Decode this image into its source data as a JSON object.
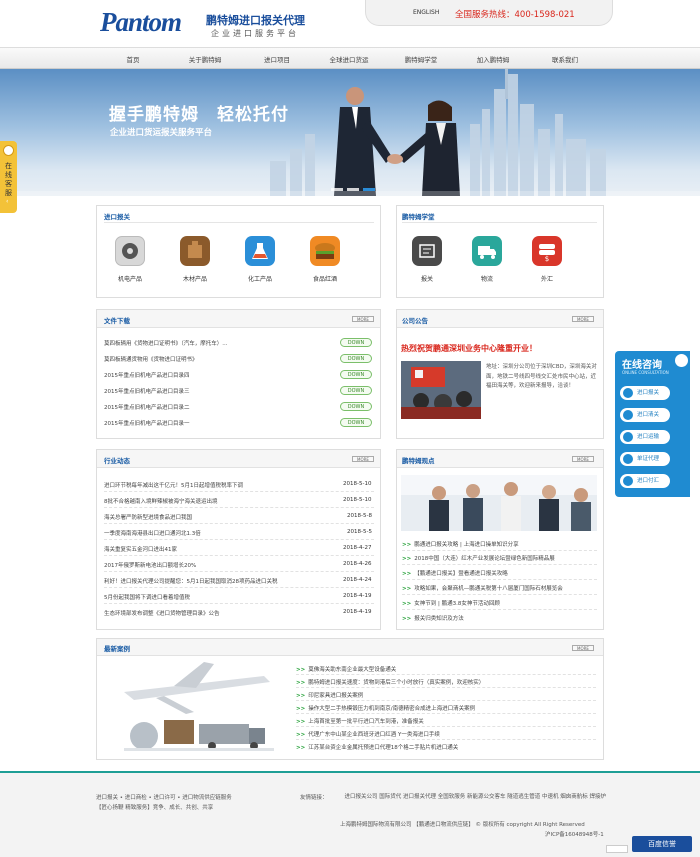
{
  "header": {
    "logo_word": "Pantom",
    "logo_cn1": "鹏特姆进口报关代理",
    "logo_cn2": "企业进口服务平台",
    "lang": "ENGLISH",
    "hotline": "全国服务热线：400-1598-021"
  },
  "nav": [
    "首页",
    "关于鹏特姆",
    "进口项目",
    "全球进口货运",
    "鹏特姆学堂",
    "加入鹏特姆",
    "联系我们"
  ],
  "banner": {
    "title": "握手鹏特姆　轻松托付",
    "subtitle": "企业进口货运报关服务平台"
  },
  "side_left": {
    "label": "在线客服"
  },
  "import_panel": {
    "title": "进口报关",
    "items": [
      "机电产品",
      "木材产品",
      "化工产品",
      "食品红酒"
    ]
  },
  "school_panel": {
    "title": "鹏特姆学堂",
    "items": [
      "报关",
      "物流",
      "外汇"
    ]
  },
  "download_panel": {
    "title": "文件下载",
    "more": "MORE",
    "down_label": "DOWN",
    "items": [
      "莫四板辆用《货物进口证明书》（汽车，摩托车）...",
      "莫四板辆通货物用《货物进口证明书》",
      "2015年重点旧机电产品进口目录四",
      "2015年重点旧机电产品进口目录三",
      "2015年重点旧机电产品进口目录二",
      "2015年重点旧机电产品进口目录一"
    ]
  },
  "notice_panel": {
    "title": "公司公告",
    "more": "MORE",
    "headline": "热烈祝贺鹏通深圳业务中心隆重开业！",
    "body": "地址：深圳分公司位于深圳CBD，深圳海关对面，地铁二号线四号线交汇处市民中心站，近福田海关等，欢迎新来报导，洽谈！"
  },
  "news_panel": {
    "title": "行业动态",
    "more": "MORE",
    "items": [
      {
        "text": "进口环节税每年减出这千亿元！5月1日起增值税税率下调",
        "date": "2018-5-10"
      },
      {
        "text": "8批不合格越南入境鲜辣椒被海宁海关退运出境",
        "date": "2018-5-10"
      },
      {
        "text": "海关总署严防新型进境食品进口我国",
        "date": "2018-5-8"
      },
      {
        "text": "一季度海南海港县出口进口通河北1.3倍",
        "date": "2018-5-5"
      },
      {
        "text": "海关重复实五金河口进出41家",
        "date": "2018-4-27"
      },
      {
        "text": "2017年俄罗斯新电池出口额增长20%",
        "date": "2018-4-26"
      },
      {
        "text": "利好！进口报关代理公司提醒您：5月1日起我国取消28项药品进口关税",
        "date": "2018-4-24"
      },
      {
        "text": "5月份起我国将下调进口看着增值税",
        "date": "2018-4-19"
      },
      {
        "text": "生态环境部发布调整《进口货物管理目录》公告",
        "date": "2018-4-19"
      }
    ]
  },
  "view_panel": {
    "title": "鹏特姆观点",
    "more": "MORE",
    "items": [
      "鹏通进口报关攻略 | 上海进口操单知识分享",
      "2018中国（大连）红木产业发展论坛暨绿色新国际精品展",
      "【鹏通进口报关】暨看通进口报关攻略",
      "攻略如果，会聚商机—鹏通关税第十八届厦门国际石材展览会",
      "女神节到 | 鹏通3.8女神节活动回顾",
      "报关归类知识及方法"
    ]
  },
  "case_panel": {
    "title": "最新案例",
    "more": "MORE",
    "items": [
      "莫佛海关助东南企业最大型设备通关",
      "鹏特姆进口报关速度：货物到港后三个小时放行（真实案例，欢迎核实）",
      "印尼家具进口报关案例",
      "操作大型二手热模锻压力机到南京/南德精密合成进上海进口清关案例",
      "上海首批至第一批平行进口汽车到港，准备报关",
      "代理广东中山某企业西班牙进口红酒 Y一类海进口手续",
      "江苏某台资企业金属托预进口代理18个格二手贴片机进口通关"
    ]
  },
  "side_right": {
    "title": "在线咨询",
    "subtitle": "ONLINE CONSULTATION",
    "buttons": [
      "进口报关",
      "进口清关",
      "进口运输",
      "单证代理",
      "进口付汇"
    ]
  },
  "footer": {
    "left1": "进口报关 • 进口商检 • 进口许可 • 进口物流供应链服务",
    "left2": "【匠心扬鞭 精致服务】竞争、成长、共创、共享",
    "links_label": "友情链接：",
    "links": "进口报关公司 国际货代 进口报关代理 全国软服务 新能源公交客车 隧道逃生管道 中速机 烟囱商航标 焊接炉",
    "copyright": "上海鹏特姆国际物流有限公司 【鹏通进口物流供应链】 © 版权所有 copyright All Right Reserved",
    "icp": "沪ICP备16048948号-1",
    "badge": "百度信誉"
  },
  "colors": {
    "brand": "#1a4e9c",
    "accent_red": "#d9261c",
    "link_green": "#28a23b",
    "float_blue": "#1f8bd1"
  }
}
